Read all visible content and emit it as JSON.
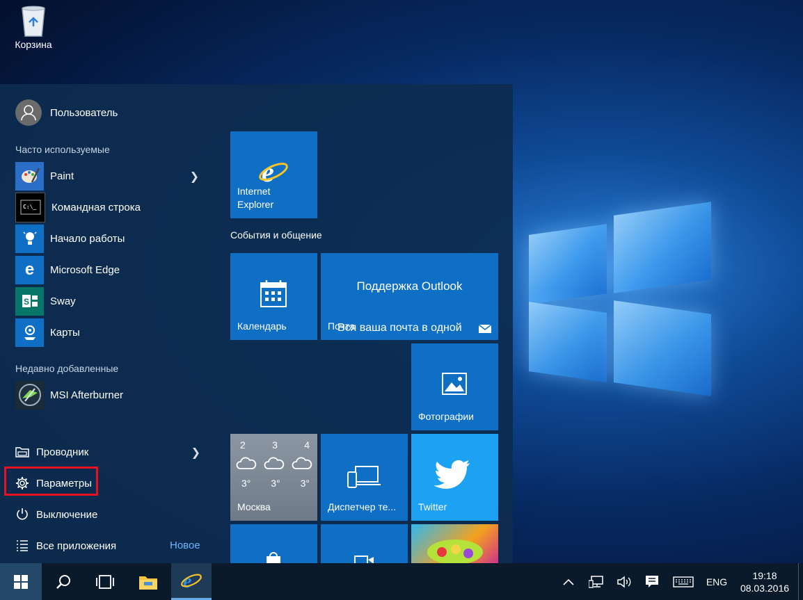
{
  "desktop": {
    "recycle_bin_label": "Корзина"
  },
  "start_menu": {
    "user_name": "Пользователь",
    "most_used_header": "Часто используемые",
    "most_used": [
      {
        "label": "Paint",
        "icon": "paint-icon",
        "has_submenu": true
      },
      {
        "label": "Командная строка",
        "icon": "command-prompt-icon"
      },
      {
        "label": "Начало работы",
        "icon": "get-started-icon"
      },
      {
        "label": "Microsoft Edge",
        "icon": "edge-icon"
      },
      {
        "label": "Sway",
        "icon": "sway-icon"
      },
      {
        "label": "Карты",
        "icon": "maps-icon"
      }
    ],
    "recently_added_header": "Недавно добавленные",
    "recently_added": [
      {
        "label": "MSI Afterburner",
        "icon": "msi-afterburner-icon"
      }
    ],
    "bottom": {
      "explorer": "Проводник",
      "settings": "Параметры",
      "power": "Выключение",
      "all_apps": "Все приложения",
      "new_badge": "Новое"
    },
    "tiles": {
      "ie": "Internet Explorer",
      "group_title": "События и общение",
      "calendar": "Календарь",
      "mail_title": "Поддержка Outlook",
      "mail_label": "Почта",
      "mail_text": "Вся ваша почта в одной",
      "photos": "Фотографии",
      "weather_days": [
        "2",
        "3",
        "4"
      ],
      "weather_temps": [
        "3°",
        "3°",
        "3°"
      ],
      "weather_city": "Москва",
      "device_manager": "Диспетчер те...",
      "twitter": "Twitter"
    }
  },
  "taskbar": {
    "language": "ENG",
    "time": "19:18",
    "date": "08.03.2016"
  },
  "colors": {
    "tile_blue": "#0f6fc5",
    "twitter_blue": "#1da1f2",
    "highlight_red": "#e81123"
  }
}
